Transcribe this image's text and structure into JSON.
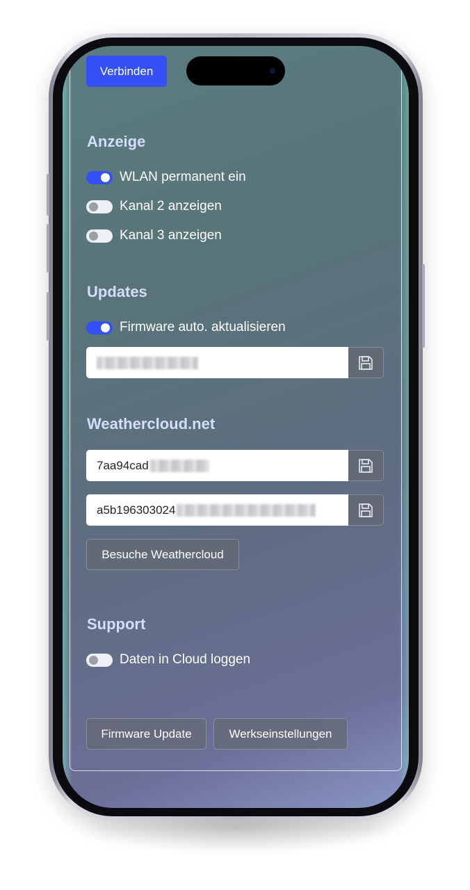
{
  "header": {
    "connect_label": "Verbinden"
  },
  "sections": {
    "anzeige": {
      "title": "Anzeige",
      "toggles": [
        {
          "label": "WLAN permanent ein",
          "on": true
        },
        {
          "label": "Kanal 2 anzeigen",
          "on": false
        },
        {
          "label": "Kanal 3 anzeigen",
          "on": false
        }
      ]
    },
    "updates": {
      "title": "Updates",
      "toggle": {
        "label": "Firmware auto. aktualisieren",
        "on": true
      },
      "input_value": ""
    },
    "weathercloud": {
      "title": "Weathercloud.net",
      "id_value": "7aa94cad",
      "key_value": "a5b196303024",
      "visit_label": "Besuche Weathercloud"
    },
    "support": {
      "title": "Support",
      "toggle": {
        "label": "Daten in Cloud loggen",
        "on": false
      }
    }
  },
  "footer": {
    "firmware_update_label": "Firmware Update",
    "factory_reset_label": "Werkseinstellungen"
  },
  "icons": {
    "save": "floppy-disk-icon"
  },
  "colors": {
    "primary": "#3551f5",
    "section_title": "#d4defa"
  }
}
